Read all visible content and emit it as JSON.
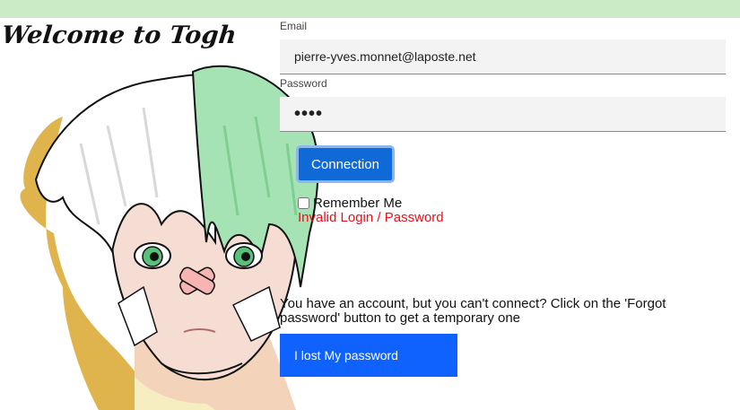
{
  "header": {
    "title": "Welcome to Togh"
  },
  "login_form": {
    "email_label": "Email",
    "email_value": "pierre-yves.monnet@laposte.net",
    "password_label": "Password",
    "password_value": "••••",
    "connect_label": "Connection",
    "remember_label": "Remember Me",
    "remember_checked": false,
    "error_message": "Invalid Login / Password"
  },
  "recovery": {
    "help_text": "You have an account, but you can't connect? Click on the 'Forgot password' button to get a temporary one",
    "lost_password_label": "I lost My password"
  },
  "colors": {
    "top_bar": "#cbeac6",
    "primary_button": "#0f6ad8",
    "lost_button": "#0f62fe",
    "error": "#e8101b"
  }
}
